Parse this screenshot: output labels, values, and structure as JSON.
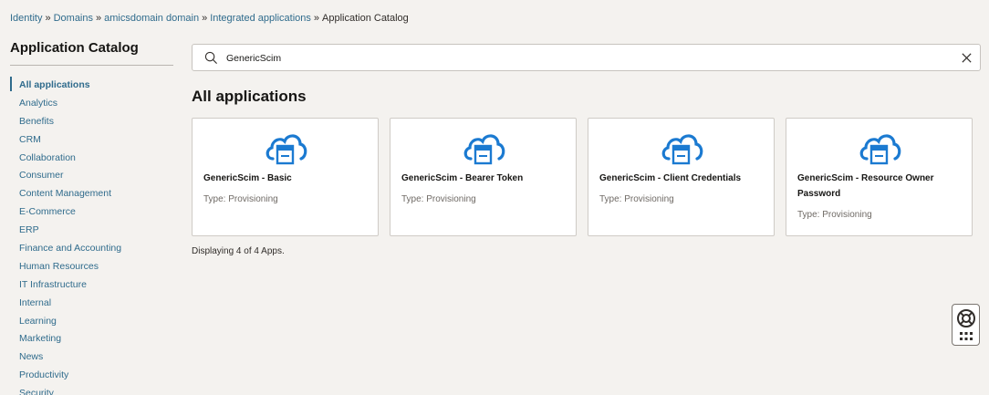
{
  "breadcrumb": {
    "items": [
      "Identity",
      "Domains",
      "amicsdomain domain",
      "Integrated applications"
    ],
    "current": "Application Catalog",
    "separator": "»"
  },
  "sidebar": {
    "title": "Application Catalog",
    "categories": [
      "All applications",
      "Analytics",
      "Benefits",
      "CRM",
      "Collaboration",
      "Consumer",
      "Content Management",
      "E-Commerce",
      "ERP",
      "Finance and Accounting",
      "Human Resources",
      "IT Infrastructure",
      "Internal",
      "Learning",
      "Marketing",
      "News",
      "Productivity",
      "Security"
    ],
    "active_index": 0
  },
  "search": {
    "value": "GenericScim",
    "placeholder": ""
  },
  "main": {
    "title": "All applications",
    "apps": [
      {
        "name": "GenericScim - Basic",
        "type": "Type: Provisioning"
      },
      {
        "name": "GenericScim - Bearer Token",
        "type": "Type: Provisioning"
      },
      {
        "name": "GenericScim - Client Credentials",
        "type": "Type: Provisioning"
      },
      {
        "name": "GenericScim - Resource Owner Password",
        "type": "Type: Provisioning"
      }
    ],
    "count_text": "Displaying 4 of 4 Apps."
  },
  "colors": {
    "link": "#2f6b8c",
    "icon_blue": "#1b7ad1",
    "background": "#f4f2ef"
  },
  "icons": {
    "app": "cloud-app-icon",
    "search": "search-icon",
    "clear": "close-icon",
    "help": "lifebuoy-icon"
  }
}
